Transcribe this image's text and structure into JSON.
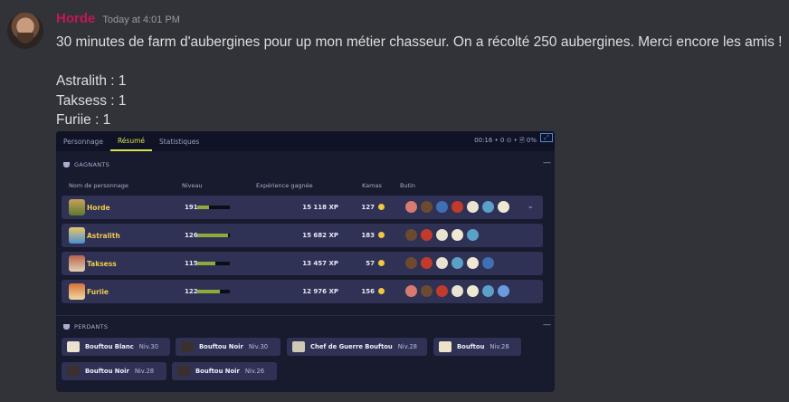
{
  "message": {
    "author": "Horde",
    "timestamp": "Today at 4:01 PM",
    "lines": [
      "30 minutes de farm d'aubergines pour up mon métier chasseur. On a récolté 250 aubergines. Merci encore les amis !",
      "Astralith : 1",
      "Taksess : 1",
      "Furiie : 1"
    ]
  },
  "game": {
    "tabs": [
      "Personnage",
      "Résumé",
      "Statistiques"
    ],
    "active_tab": "Résumé",
    "status": "00:16 • 0 ⊙ • 🗎 0%",
    "winners_title": "GAGNANTS",
    "losers_title": "PERDANTS",
    "columns": {
      "name": "Nom de personnage",
      "level": "Niveau",
      "xp": "Expérience gagnée",
      "kamas": "Kamas",
      "loot": "Butin"
    },
    "winners": [
      {
        "name": "Horde",
        "level": "191",
        "level_progress": 0.35,
        "xp": "15 118 XP",
        "kamas": "127"
      },
      {
        "name": "Astralith",
        "level": "126",
        "level_progress": 0.95,
        "xp": "15 682 XP",
        "kamas": "183"
      },
      {
        "name": "Taksess",
        "level": "115",
        "level_progress": 0.55,
        "xp": "13 457 XP",
        "kamas": "57"
      },
      {
        "name": "Furiie",
        "level": "122",
        "level_progress": 0.7,
        "xp": "12 976 XP",
        "kamas": "156"
      }
    ],
    "losers": [
      {
        "name": "Bouftou Blanc",
        "level": "Niv.30"
      },
      {
        "name": "Bouftou Noir",
        "level": "Niv.30"
      },
      {
        "name": "Chef de Guerre Bouftou",
        "level": "Niv.28"
      },
      {
        "name": "Bouftou",
        "level": "Niv.28"
      },
      {
        "name": "Bouftou Noir",
        "level": "Niv.28"
      },
      {
        "name": "Bouftou Noir",
        "level": "Niv.26"
      }
    ],
    "colors": {
      "accent": "#d9e34a",
      "username": "#c2185b",
      "row_bg": "#2f3255",
      "name_gold": "#f2c94c"
    }
  }
}
